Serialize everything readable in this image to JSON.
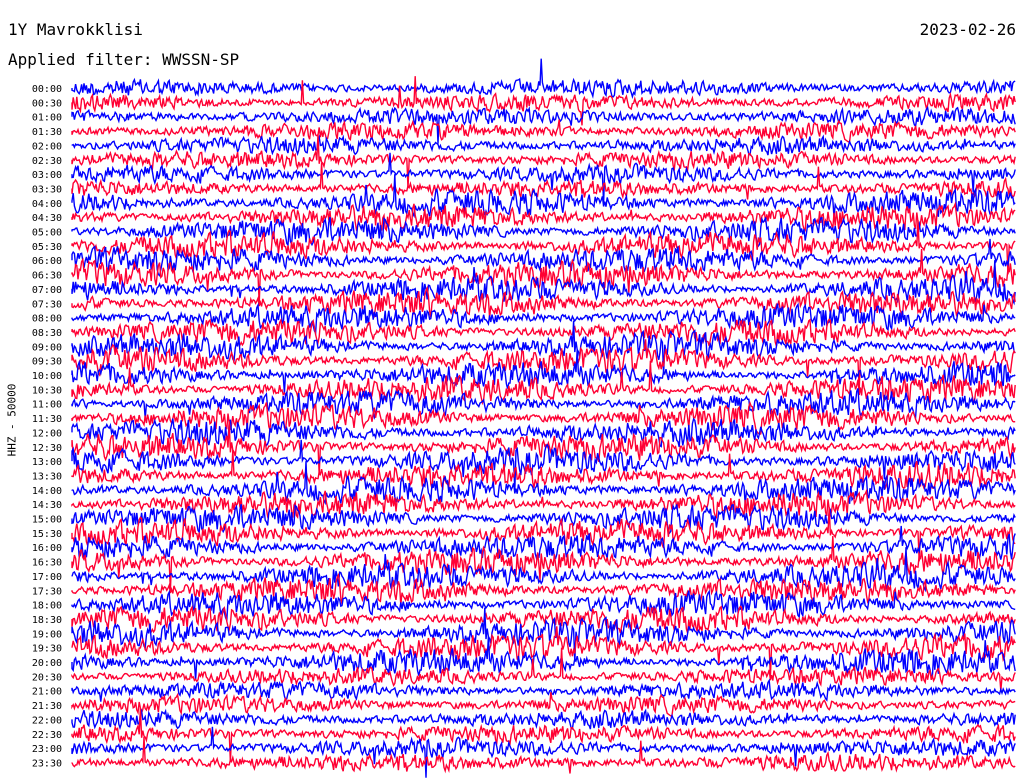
{
  "header": {
    "title": "1Y Mavrokklisi",
    "date": "2023-02-26",
    "filter": "Applied filter: WWSSN-SP"
  },
  "chart_data": {
    "type": "line",
    "ylabel": "HHZ - 50000",
    "tick_labels": [
      "00:00",
      "00:30",
      "01:00",
      "01:30",
      "02:00",
      "02:30",
      "03:00",
      "03:30",
      "04:00",
      "04:30",
      "05:00",
      "05:30",
      "06:00",
      "06:30",
      "07:00",
      "07:30",
      "08:00",
      "08:30",
      "09:00",
      "09:30",
      "10:00",
      "10:30",
      "11:00",
      "11:30",
      "12:00",
      "12:30",
      "13:00",
      "13:30",
      "14:00",
      "14:30",
      "15:00",
      "15:30",
      "16:00",
      "16:30",
      "17:00",
      "17:30",
      "18:00",
      "18:30",
      "19:00",
      "19:30",
      "20:00",
      "20:30",
      "21:00",
      "21:30",
      "22:00",
      "22:30",
      "23:00",
      "23:30"
    ],
    "series_colors": [
      "#0000ff",
      "#ff0033"
    ],
    "grid": false,
    "legend": "none"
  }
}
